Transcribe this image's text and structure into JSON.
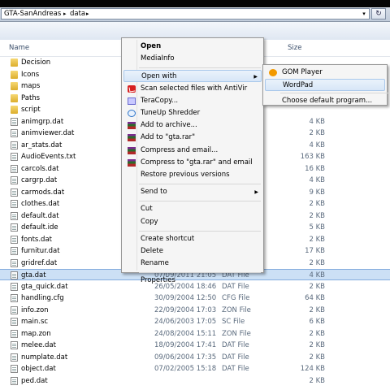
{
  "address": {
    "crumbs": [
      "GTA-SanAndreas",
      "data"
    ],
    "sep": "▸",
    "dropdown": "▾",
    "refresh": "↻"
  },
  "columns": {
    "name": "Name",
    "size": "Size"
  },
  "files": [
    {
      "name": "Decision",
      "type": "folder",
      "date": "",
      "ftype": "",
      "size": ""
    },
    {
      "name": "Icons",
      "type": "folder",
      "date": "",
      "ftype": "",
      "size": ""
    },
    {
      "name": "maps",
      "type": "folder",
      "date": "",
      "ftype": "",
      "size": ""
    },
    {
      "name": "Paths",
      "type": "folder",
      "date": "",
      "ftype": "",
      "size": ""
    },
    {
      "name": "script",
      "type": "folder",
      "date": "",
      "ftype": "",
      "size": ""
    },
    {
      "name": "animgrp.dat",
      "type": "file",
      "date": "",
      "ftype": "",
      "size": "4 KB"
    },
    {
      "name": "animviewer.dat",
      "type": "file",
      "date": "",
      "ftype": "",
      "size": "2 KB"
    },
    {
      "name": "ar_stats.dat",
      "type": "file",
      "date": "",
      "ftype": "",
      "size": "4 KB"
    },
    {
      "name": "AudioEvents.txt",
      "type": "file",
      "date": "",
      "ftype": "",
      "size": "163 KB"
    },
    {
      "name": "carcols.dat",
      "type": "file",
      "date": "",
      "ftype": "",
      "size": "16 KB"
    },
    {
      "name": "cargrp.dat",
      "type": "file",
      "date": "",
      "ftype": "",
      "size": "4 KB"
    },
    {
      "name": "carmods.dat",
      "type": "file",
      "date": "",
      "ftype": "",
      "size": "9 KB"
    },
    {
      "name": "clothes.dat",
      "type": "file",
      "date": "",
      "ftype": "",
      "size": "2 KB"
    },
    {
      "name": "default.dat",
      "type": "file",
      "date": "",
      "ftype": "",
      "size": "2 KB"
    },
    {
      "name": "default.ide",
      "type": "file",
      "date": "",
      "ftype": "",
      "size": "5 KB"
    },
    {
      "name": "fonts.dat",
      "type": "file",
      "date": "",
      "ftype": "",
      "size": "2 KB"
    },
    {
      "name": "furnitur.dat",
      "type": "file",
      "date": "",
      "ftype": "",
      "size": "17 KB"
    },
    {
      "name": "gridref.dat",
      "type": "file",
      "date": "",
      "ftype": "",
      "size": "2 KB"
    },
    {
      "name": "gta.dat",
      "type": "file",
      "date": "07/09/2011 21:05",
      "ftype": "DAT File",
      "size": "4 KB",
      "selected": true
    },
    {
      "name": "gta_quick.dat",
      "type": "file",
      "date": "26/05/2004 18:46",
      "ftype": "DAT File",
      "size": "2 KB"
    },
    {
      "name": "handling.cfg",
      "type": "file",
      "date": "30/09/2004 12:50",
      "ftype": "CFG File",
      "size": "64 KB"
    },
    {
      "name": "info.zon",
      "type": "file",
      "date": "22/09/2004 17:03",
      "ftype": "ZON File",
      "size": "2 KB"
    },
    {
      "name": "main.sc",
      "type": "file",
      "date": "24/06/2003 17:05",
      "ftype": "SC File",
      "size": "6 KB"
    },
    {
      "name": "map.zon",
      "type": "file",
      "date": "24/08/2004 15:11",
      "ftype": "ZON File",
      "size": "2 KB"
    },
    {
      "name": "melee.dat",
      "type": "file",
      "date": "18/09/2004 17:41",
      "ftype": "DAT File",
      "size": "2 KB"
    },
    {
      "name": "numplate.dat",
      "type": "file",
      "date": "09/06/2004 17:35",
      "ftype": "DAT File",
      "size": "2 KB"
    },
    {
      "name": "object.dat",
      "type": "file",
      "date": "07/02/2005 15:18",
      "ftype": "DAT File",
      "size": "124 KB"
    },
    {
      "name": "ped.dat",
      "type": "file",
      "date": "",
      "ftype": "",
      "size": "2 KB"
    }
  ],
  "context_menu": [
    {
      "label": "Open",
      "bold": true
    },
    {
      "label": "MediaInfo"
    },
    {
      "sep": true
    },
    {
      "label": "Open with",
      "submenu": true,
      "highlight": true
    },
    {
      "label": "Scan selected files with AntiVir",
      "icon": "avira"
    },
    {
      "label": "TeraCopy...",
      "icon": "tera"
    },
    {
      "label": "TuneUp Shredder",
      "icon": "tuneup"
    },
    {
      "label": "Add to archive...",
      "icon": "rar"
    },
    {
      "label": "Add to \"gta.rar\"",
      "icon": "rar"
    },
    {
      "label": "Compress and email...",
      "icon": "rar"
    },
    {
      "label": "Compress to \"gta.rar\" and email",
      "icon": "rar"
    },
    {
      "label": "Restore previous versions"
    },
    {
      "sep": true
    },
    {
      "label": "Send to",
      "submenu": true
    },
    {
      "sep": true
    },
    {
      "label": "Cut"
    },
    {
      "label": "Copy"
    },
    {
      "sep": true
    },
    {
      "label": "Create shortcut"
    },
    {
      "label": "Delete"
    },
    {
      "label": "Rename"
    },
    {
      "sep": true
    },
    {
      "label": "Properties"
    }
  ],
  "submenu": [
    {
      "label": "GOM Player",
      "icon": "gom"
    },
    {
      "label": "WordPad",
      "highlight": true
    },
    {
      "sep": true
    },
    {
      "label": "Choose default program..."
    }
  ],
  "submenu_arrow": "▶"
}
